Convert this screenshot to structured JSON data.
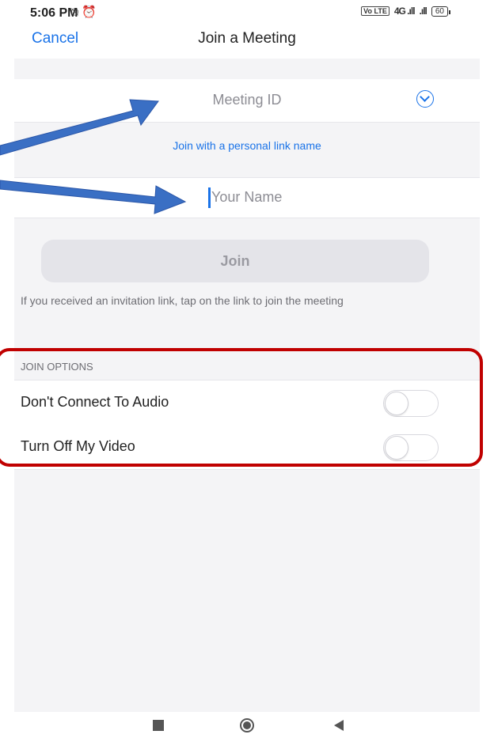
{
  "status_bar": {
    "time": "5:06 PM",
    "left_icons": "⍉ ⏰",
    "volte": "Vo LTE",
    "signal_1": "4G .ıll",
    "signal_2": ".ıll",
    "battery": "60"
  },
  "header": {
    "cancel_label": "Cancel",
    "title": "Join a Meeting"
  },
  "meeting_id": {
    "placeholder": "Meeting ID",
    "dropdown_icon": "chevron-down-circle-icon"
  },
  "personal_link": {
    "label": "Join with a personal link name"
  },
  "name_field": {
    "placeholder": "Your Name"
  },
  "join_button": {
    "label": "Join"
  },
  "hint_text": "If you received an invitation link, tap on the link to join the meeting",
  "join_options": {
    "header": "JOIN OPTIONS",
    "items": [
      {
        "label": "Don't Connect To Audio",
        "enabled": false
      },
      {
        "label": "Turn Off My Video",
        "enabled": false
      }
    ]
  },
  "annotations": {
    "arrow_color": "#3a6fc4",
    "highlight_color": "#c00000"
  },
  "accent_color": "#1a73e8"
}
